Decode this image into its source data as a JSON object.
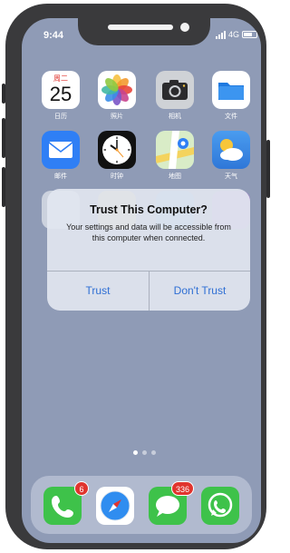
{
  "status": {
    "time": "9:44",
    "network": "4G"
  },
  "apps": {
    "calendar": {
      "weekday": "周二",
      "day": "25",
      "label": "日历"
    },
    "photos": {
      "label": "照片"
    },
    "camera": {
      "label": "相机"
    },
    "files": {
      "label": "文件"
    },
    "mail": {
      "label": "邮件"
    },
    "clock": {
      "label": "时钟"
    },
    "maps": {
      "label": "地图"
    },
    "weather": {
      "label": "天气"
    }
  },
  "dialog": {
    "title": "Trust This Computer?",
    "message": "Your settings and data will be accessible from this computer when connected.",
    "trust_label": "Trust",
    "dont_trust_label": "Don't Trust"
  },
  "dock": {
    "phone_badge": "6",
    "messages_badge": "336"
  },
  "page_indicator": {
    "pages": 3,
    "current": 1
  },
  "colors": {
    "wallpaper": "#8f9bb6",
    "accent_blue": "#2f6fd4",
    "badge_red": "#e0342e",
    "phone_frame": "#3a3a3c"
  }
}
